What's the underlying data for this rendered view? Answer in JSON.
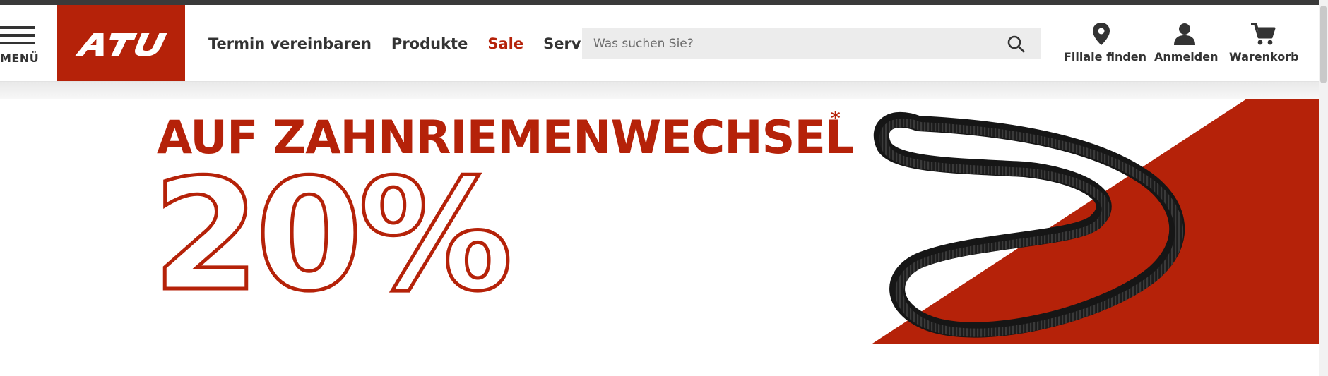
{
  "colors": {
    "brand_red": "#b52209",
    "text_dark": "#333333",
    "search_bg": "#ececec",
    "top_strip": "#3a3a3a"
  },
  "header": {
    "menu": {
      "label": "MENÜ",
      "icon": "hamburger-icon"
    },
    "logo": {
      "text": "ATU"
    },
    "nav": [
      {
        "label": "Termin vereinbaren"
      },
      {
        "label": "Produkte"
      },
      {
        "label": "Sale",
        "accent": true
      },
      {
        "label": "Services"
      }
    ],
    "search": {
      "placeholder": "Was suchen Sie?",
      "value": "",
      "icon": "search-icon"
    },
    "tools": [
      {
        "label": "Filiale finden",
        "icon": "location-pin-icon"
      },
      {
        "label": "Anmelden",
        "icon": "user-icon"
      },
      {
        "label": "Warenkorb",
        "icon": "cart-icon"
      }
    ]
  },
  "banner": {
    "headline": "AUF ZAHNRIEMENWECHSEL",
    "asterisk": "*",
    "discount": "20%",
    "image": "timing-belt-image"
  }
}
